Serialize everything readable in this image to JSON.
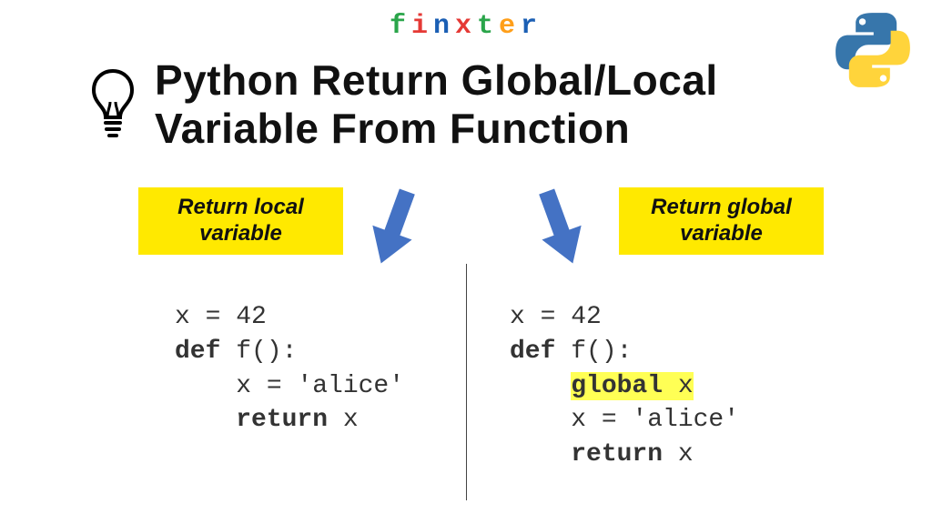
{
  "brand": {
    "letters": [
      "f",
      "i",
      "n",
      "x",
      "t",
      "e",
      "r"
    ],
    "colors": [
      "#2aa54a",
      "#e53935",
      "#1b5fb4",
      "#e53935",
      "#2aa54a",
      "#ff9f1a",
      "#1b5fb4"
    ]
  },
  "title": "Python Return Global/Local Variable From Function",
  "labels": {
    "left_line1": "Return local",
    "left_line2": "variable",
    "right_line1": "Return global",
    "right_line2": "variable"
  },
  "arrow_color": "#4472c4",
  "code_left": {
    "l1_a": "x = 42",
    "l2_a": "def",
    "l2_b": " f():",
    "l3_a": "    x = 'alice'",
    "l4_a": "    ",
    "l4_b": "return",
    "l4_c": " x"
  },
  "code_right": {
    "l1_a": "x = 42",
    "l2_a": "def",
    "l2_b": " f():",
    "l3_a": "    ",
    "l3_b": "global",
    "l3_c": " x",
    "l4_a": "    x = 'alice'",
    "l5_a": "    ",
    "l5_b": "return",
    "l5_c": " x"
  }
}
